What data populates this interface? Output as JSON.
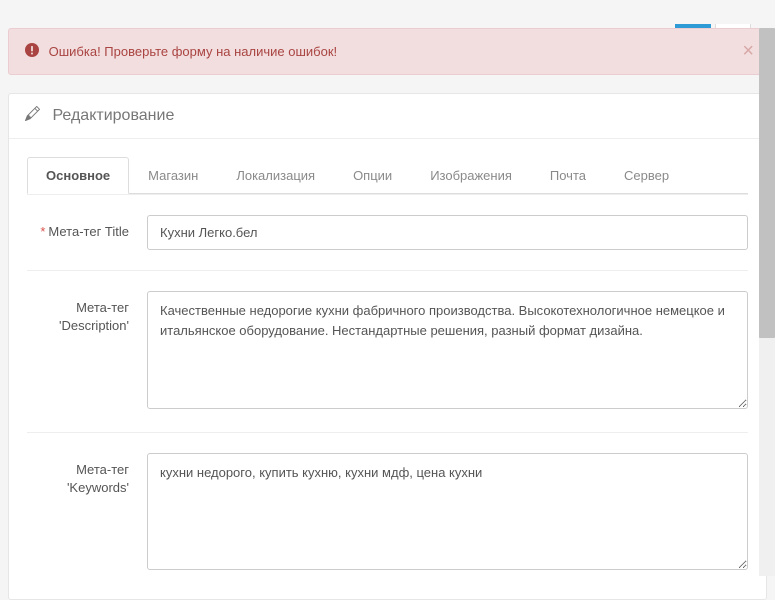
{
  "alert": {
    "text": "Ошибка! Проверьте форму на наличие ошибок!",
    "close": "×"
  },
  "panel": {
    "title": "Редактирование"
  },
  "tabs": [
    {
      "label": "Основное",
      "active": true
    },
    {
      "label": "Магазин",
      "active": false
    },
    {
      "label": "Локализация",
      "active": false
    },
    {
      "label": "Опции",
      "active": false
    },
    {
      "label": "Изображения",
      "active": false
    },
    {
      "label": "Почта",
      "active": false
    },
    {
      "label": "Сервер",
      "active": false
    }
  ],
  "form": {
    "meta_title": {
      "label": "Мета-тег Title",
      "required": "*",
      "value": "Кухни Легко.бел"
    },
    "meta_description": {
      "label": "Мета-тег 'Description'",
      "value": "Качественные недорогие кухни фабричного производства. Высокотехнологичное немецкое и итальянское оборудование. Нестандартные решения, разный формат дизайна."
    },
    "meta_keywords": {
      "label": "Мета-тег 'Keywords'",
      "value": "кухни недорого, купить кухню, кухни мдф, цена кухни"
    }
  }
}
